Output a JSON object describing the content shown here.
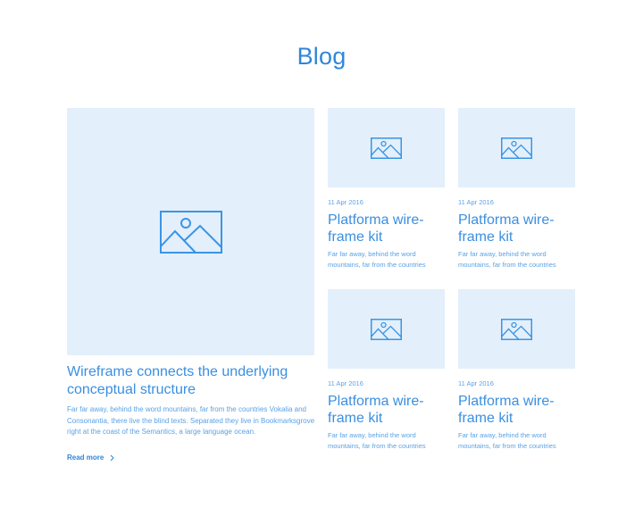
{
  "page": {
    "title": "Blog"
  },
  "featured": {
    "image_icon": "image-placeholder-icon",
    "title": "Wireframe connects the underlying conceptual structure",
    "description": "Far far away, behind the word mountains, far from the countries Vokalia and Consonantia, there live the blind texts. Separated they live in Bookmarksgrove right at the coast of the Semantics, a large language ocean.",
    "read_more_label": "Read more",
    "read_more_icon": "chevron-right-icon"
  },
  "cards": [
    {
      "date": "11 Apr 2016",
      "title": "Platforma wire-frame kit",
      "description": "Far far away, behind the word mountains, far from the countries"
    },
    {
      "date": "11 Apr 2016",
      "title": "Platforma wire-frame kit",
      "description": "Far far away, behind the word mountains, far from the countries"
    },
    {
      "date": "11 Apr 2016",
      "title": "Platforma wire-frame kit",
      "description": "Far far away, behind the word mountains, far from the countries"
    },
    {
      "date": "11 Apr 2016",
      "title": "Platforma wire-frame kit",
      "description": "Far far away, behind the word mountains, far from the countries"
    }
  ],
  "colors": {
    "accent": "#2f86d9",
    "placeholder_bg": "#e3effb",
    "icon_stroke": "#3a95e4"
  }
}
